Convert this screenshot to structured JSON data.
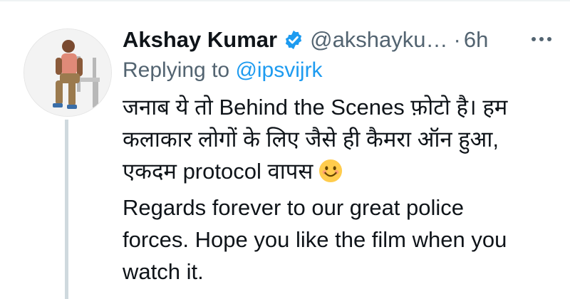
{
  "tweet": {
    "author_name": "Akshay Kumar",
    "handle": "@akshayku…",
    "separator": "·",
    "time": "6h",
    "more_icon": "more-horizontal-icon",
    "verified_icon": "verified-badge-icon",
    "reply_prefix": "Replying to ",
    "reply_to": "@ipsvijrk",
    "body_lines": [
      "जनाब ये तो Behind the Scenes फ़ोटो है। हम",
      "कलाकार लोगों के लिए जैसे ही कैमरा ऑन हुआ,",
      "एकदम protocol वापस",
      "Regards forever to our great police",
      "forces. Hope you like the film when you",
      "watch it."
    ],
    "emoji": "smiling-face-icon"
  },
  "colors": {
    "accent": "#1d9bf0",
    "secondary_text": "#536471",
    "thread_line": "#cfd9de"
  }
}
